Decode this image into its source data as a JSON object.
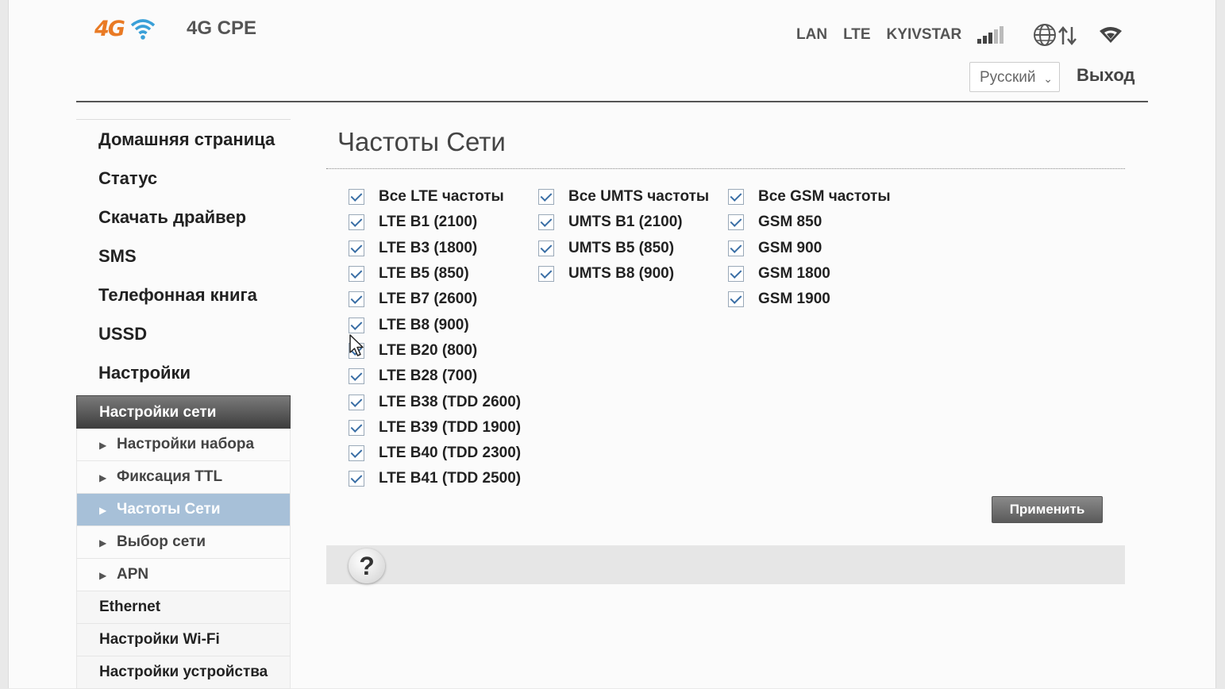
{
  "header": {
    "logo_text": "4G",
    "title": "4G CPE",
    "status": {
      "connection": "LAN",
      "network_type": "LTE",
      "operator": "KYIVSTAR"
    },
    "language": "Русский",
    "logout": "Выход",
    "icons": [
      "signal-strength-icon",
      "globe-data-icon",
      "wifi-icon"
    ]
  },
  "sidebar": {
    "items": [
      {
        "label": "Домашняя страница"
      },
      {
        "label": "Статус"
      },
      {
        "label": "Скачать драйвер"
      },
      {
        "label": "SMS"
      },
      {
        "label": "Телефонная книга"
      },
      {
        "label": "USSD"
      },
      {
        "label": "Настройки"
      }
    ],
    "section_header": "Настройки сети",
    "subitems": [
      {
        "label": "Настройки набора",
        "active": false
      },
      {
        "label": "Фиксация TTL",
        "active": false
      },
      {
        "label": "Частоты Сети",
        "active": true
      },
      {
        "label": "Выбор сети",
        "active": false
      },
      {
        "label": "APN",
        "active": false
      }
    ],
    "bottom_items": [
      {
        "label": "Ethernet"
      },
      {
        "label": "Настройки Wi-Fi"
      },
      {
        "label": "Настройки устройства"
      }
    ]
  },
  "main": {
    "title": "Частоты Сети",
    "lte": [
      "Все LTE частоты",
      "LTE B1 (2100)",
      "LTE B3 (1800)",
      "LTE B5 (850)",
      "LTE B7 (2600)",
      "LTE B8 (900)",
      "LTE B20 (800)",
      "LTE B28 (700)",
      "LTE B38 (TDD 2600)",
      "LTE B39 (TDD 1900)",
      "LTE B40 (TDD 2300)",
      "LTE B41 (TDD 2500)"
    ],
    "umts": [
      "Все UMTS частоты",
      "UMTS B1 (2100)",
      "UMTS B5 (850)",
      "UMTS B8 (900)"
    ],
    "gsm": [
      "Все GSM частоты",
      "GSM 850",
      "GSM 900",
      "GSM 1800",
      "GSM 1900"
    ],
    "all_checked": true,
    "apply_label": "Применить",
    "help_label": "?"
  },
  "colors": {
    "accent_orange": "#e97a24",
    "wifi_blue": "#3aa0d8",
    "active_item": "#a7c0d8"
  }
}
